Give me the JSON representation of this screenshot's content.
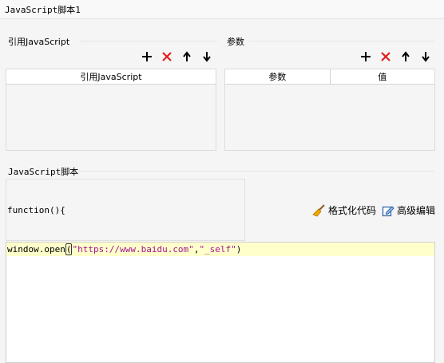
{
  "window": {
    "title": "JavaScript脚本1"
  },
  "ref_section": {
    "label": "引用JavaScript",
    "column": "引用JavaScript"
  },
  "param_section": {
    "label": "参数",
    "columns": [
      "参数",
      "值"
    ]
  },
  "toolbar_icons": [
    "plus-icon",
    "delete-x-icon",
    "arrow-up-icon",
    "arrow-down-icon"
  ],
  "script_section": {
    "label": "JavaScript脚本",
    "function_text": "function(){",
    "format_button": "格式化代码",
    "advanced_edit_button": "高级编辑"
  },
  "editor": {
    "code_prefix": "window.open",
    "open_paren": "(",
    "arg1": "\"https://www.baidu.com\"",
    "comma": ",",
    "arg2": "\"_self\"",
    "close_paren": ")"
  },
  "colors": {
    "delete": "#e02020",
    "string": "#a31592",
    "highlight_line": "#ffffcc"
  }
}
